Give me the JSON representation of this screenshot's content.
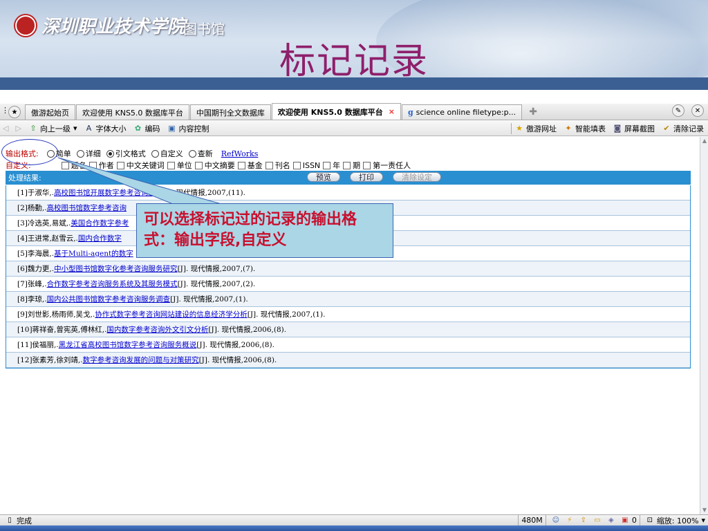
{
  "banner": {
    "school_name": "深圳职业技术学院",
    "library": "图书馆",
    "slide_title": "标记记录"
  },
  "tabs": [
    {
      "label": "傲游起始页",
      "active": false
    },
    {
      "label": "欢迎使用 KNS5.0 数据库平台",
      "active": false
    },
    {
      "label": "中国期刊全文数据库",
      "active": false
    },
    {
      "label": "欢迎使用 KNS5.0 数据库平台",
      "active": true,
      "close": "×"
    },
    {
      "label": "science online filetype:p...",
      "active": false,
      "favicon": "g"
    }
  ],
  "navbar": {
    "up": "向上一级",
    "font": "字体大小",
    "encoding": "编码",
    "content_control": "内容控制",
    "bookmarks": "傲游网址",
    "smart_fill": "智能填表",
    "screenshot": "屏幕截图",
    "clear": "清除记录"
  },
  "format_row": {
    "label": "输出格式:",
    "options": [
      "简单",
      "详细",
      "引文格式",
      "自定义",
      "查新"
    ],
    "selected": "引文格式",
    "refworks": "RefWorks"
  },
  "custom_row": {
    "label": "自定义:",
    "fields": [
      "题名",
      "作者",
      "中文关键词",
      "单位",
      "中文摘要",
      "基金",
      "刊名",
      "ISSN",
      "年",
      "期",
      "第一责任人"
    ]
  },
  "result_bar": {
    "label": "处理结果:",
    "preview": "预览",
    "print": "打印",
    "clear": "清除设定"
  },
  "records": [
    {
      "prefix": "[1]于淑华,.",
      "title": "高校图书馆开展数字参考咨询服务",
      "suffix": "[J]. 现代情报,2007,(11)."
    },
    {
      "prefix": "[2]杨勤,.",
      "title": "高校图书馆数字参考咨询",
      "suffix": ""
    },
    {
      "prefix": "[3]冷选英,易斌,.",
      "title": "美国合作数字参考",
      "suffix": ""
    },
    {
      "prefix": "[4]王进常,赵雪云,.",
      "title": "国内合作数字",
      "suffix": ""
    },
    {
      "prefix": "[5]李海晨,.",
      "title": "基于Multi-agent的数字",
      "suffix": ""
    },
    {
      "prefix": "[6]魏力更,.",
      "title": "中小型图书馆数字化参考咨询服务研究",
      "suffix": "[J]. 现代情报,2007,(7)."
    },
    {
      "prefix": "[7]张峰,.",
      "title": "合作数字参考咨询服务系统及其服务模式",
      "suffix": "[J]. 现代情报,2007,(2)."
    },
    {
      "prefix": "[8]李琼,.",
      "title": "国内公共图书馆数字参考咨询服务调查",
      "suffix": "[J]. 现代情报,2007,(1)."
    },
    {
      "prefix": "[9]刘世影,杨雨师,吴戈,.",
      "title": "协作式数字参考咨询网站建设的信息经济学分析",
      "suffix": "[J]. 现代情报,2007,(1)."
    },
    {
      "prefix": "[10]蒋祥奋,曾宪英,傅林红,.",
      "title": "国内数字参考咨询外文引文分析",
      "suffix": "[J]. 现代情报,2006,(8)."
    },
    {
      "prefix": "[11]侯福丽,.",
      "title": "黑龙江省高校图书馆数字参考咨询服务概说",
      "suffix": "[J]. 现代情报,2006,(8)."
    },
    {
      "prefix": "[12]张素芳,徐刘靖,.",
      "title": "数字参考咨询发展的问题与对策研究",
      "suffix": "[J]. 现代情报,2006,(8)."
    }
  ],
  "callout": {
    "text": "可以选择标记过的记录的输出格式：输出字段,自定义"
  },
  "status": {
    "left": "完成",
    "memory": "480M",
    "counter": "0",
    "zoom": "缩放: 100%"
  }
}
